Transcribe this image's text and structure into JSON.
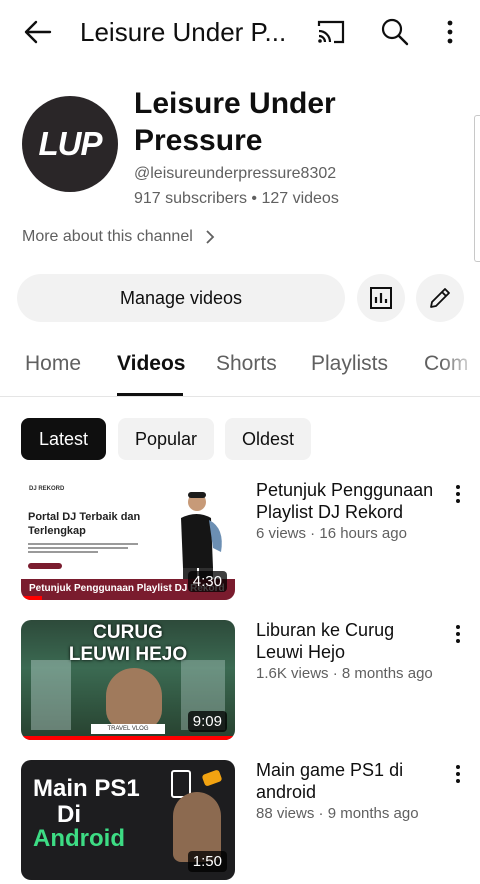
{
  "topbar": {
    "title": "Leisure Under P..."
  },
  "channel": {
    "avatar_text": "LUP",
    "name": "Leisure Under Pressure",
    "handle": "@leisureunderpressure8302",
    "stats": "917 subscribers • 127 videos",
    "more_about": "More about this channel"
  },
  "actions": {
    "manage_label": "Manage videos"
  },
  "tabs": [
    {
      "label": "Home"
    },
    {
      "label": "Videos"
    },
    {
      "label": "Shorts"
    },
    {
      "label": "Playlists"
    },
    {
      "label": "Com"
    }
  ],
  "filters": [
    {
      "label": "Latest"
    },
    {
      "label": "Popular"
    },
    {
      "label": "Oldest"
    }
  ],
  "videos": [
    {
      "title": "Petunjuk Penggunaan Playlist DJ Rekord",
      "meta": "6 views · 16 hours ago",
      "duration": "4:30",
      "watched": 0.1,
      "thumb": {
        "brand": "DJ REKORD",
        "headline": "Portal DJ Terbaik dan Terlengkap",
        "band": "Petunjuk Penggunaan Playlist DJ Rekord"
      }
    },
    {
      "title": "Liburan ke Curug Leuwi Hejo",
      "meta": "1.6K views · 8 months ago",
      "duration": "9:09",
      "watched": 1.0,
      "thumb": {
        "headline_1": "CURUG",
        "headline_2": "LEUWI HEJO",
        "tag": "TRAVEL VLOG"
      }
    },
    {
      "title": "Main game PS1 di android",
      "meta": "88 views · 9 months ago",
      "duration": "1:50",
      "thumb": {
        "line1": "Main PS1",
        "line2": "Di",
        "line3": "Android"
      }
    }
  ],
  "colors": {
    "accent": "#0f0f0f",
    "progress": "#ff0000",
    "secondary_text": "#606060",
    "chip_bg": "#f2f2f2"
  }
}
